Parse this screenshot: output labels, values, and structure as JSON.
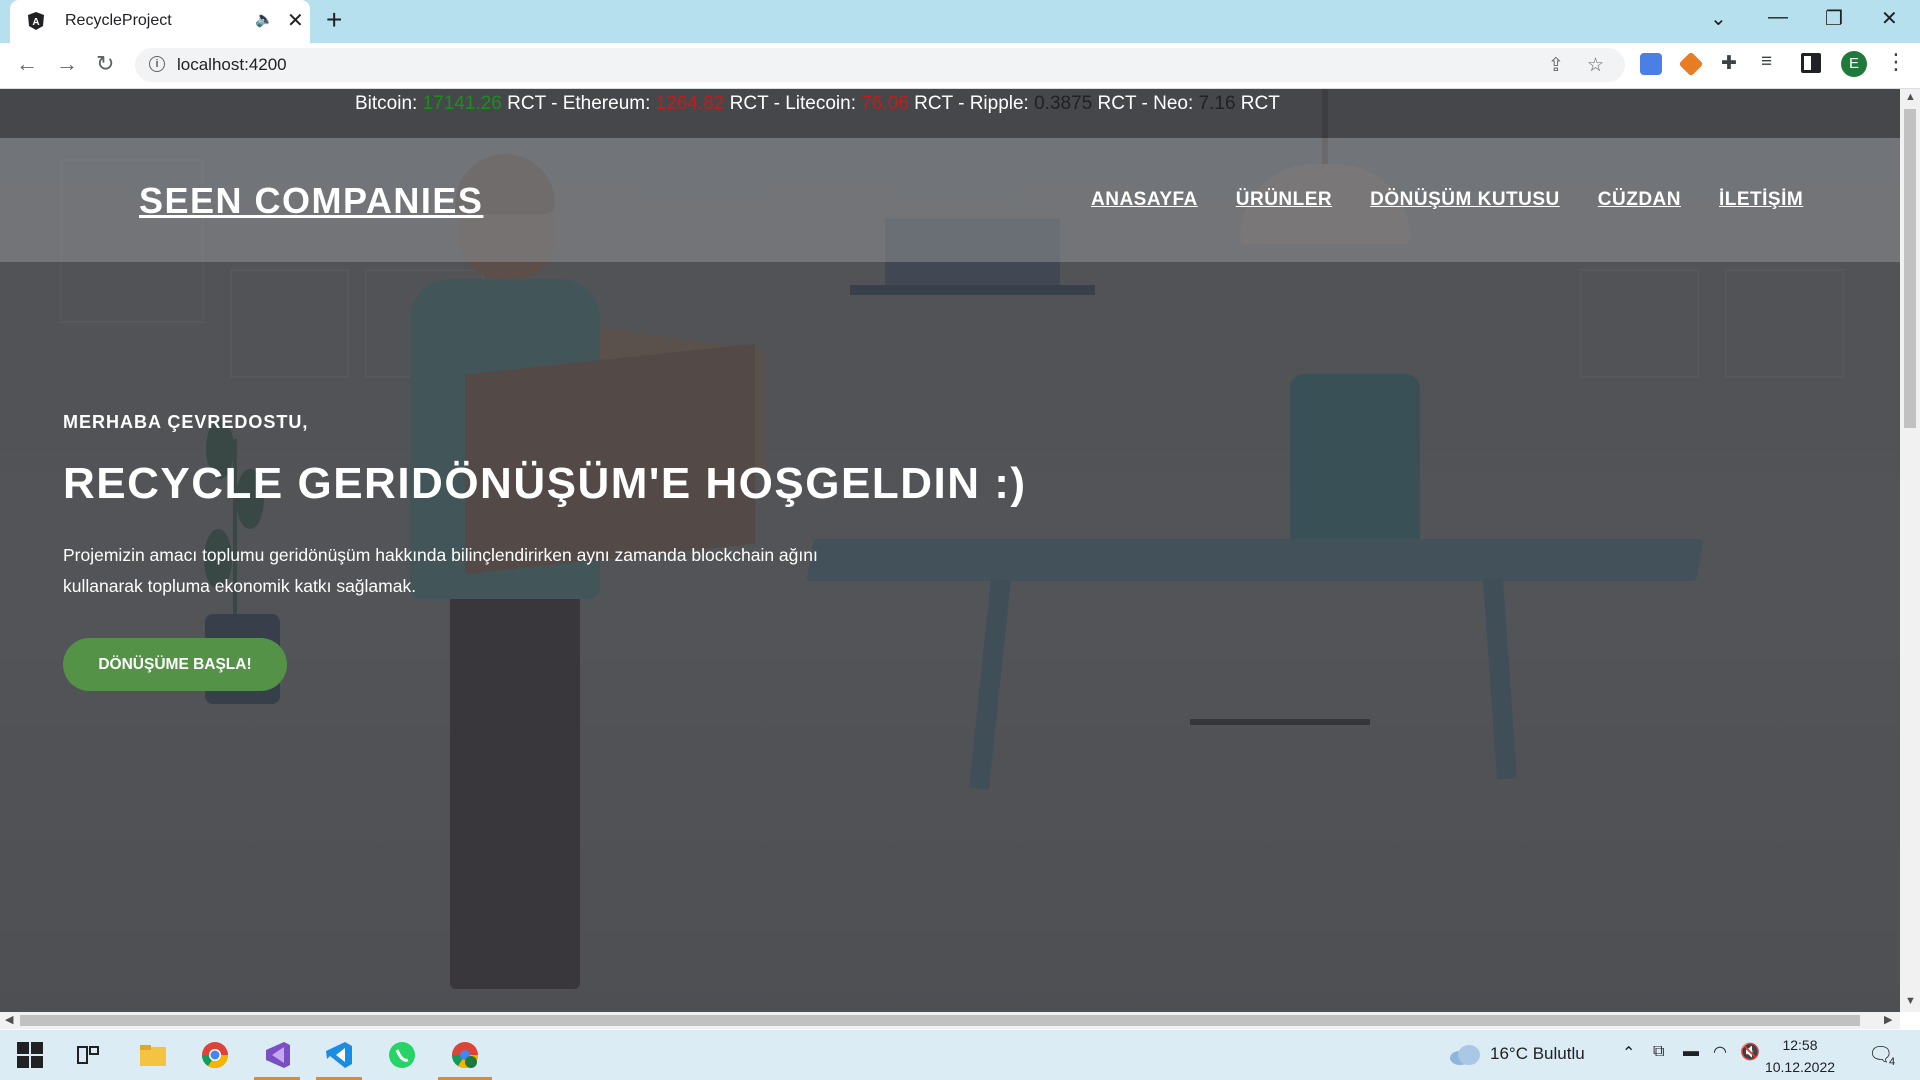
{
  "browser": {
    "tab_title": "RecycleProject",
    "new_tab_symbol": "+",
    "url": "localhost:4200",
    "profile_initial": "E",
    "window_controls": [
      "chevron-down-icon",
      "minimize-icon",
      "restore-icon",
      "close-icon"
    ],
    "extensions": [
      "translate-icon",
      "metamask-fox-icon",
      "puzzle-extensions-icon",
      "media-queue-icon",
      "side-panel-icon"
    ]
  },
  "ticker": {
    "items": [
      {
        "name": "Bitcoin:",
        "value": "17141.26",
        "unit": "RCT",
        "color": "#1a8f1a"
      },
      {
        "name": "Ethereum:",
        "value": "1264.82",
        "unit": "RCT",
        "color": "#c21d1d"
      },
      {
        "name": "Litecoin:",
        "value": "76.06",
        "unit": "RCT",
        "color": "#c21d1d"
      },
      {
        "name": "Ripple:",
        "value": "0.3875",
        "unit": "RCT",
        "color": "#202124"
      },
      {
        "name": "Neo:",
        "value": "7.16",
        "unit": "RCT",
        "color": "#202124"
      }
    ],
    "separator": " - "
  },
  "navbar": {
    "brand": "SEEN COMPANIES",
    "links": [
      "ANASAYFA",
      "ÜRÜNLER",
      "DÖNÜŞÜM KUTUSU",
      "CÜZDAN",
      "İLETİŞİM"
    ]
  },
  "hero": {
    "greeting": "MERHABA ÇEVREDOSTU,",
    "headline": "RECYCLE GERIDÖNÜŞÜM'E HOŞGELDIN :)",
    "description": "Projemizin amacı toplumu geridönüşüm hakkında bilinçlendirirken aynı zamanda blockchain ağını kullanarak topluma ekonomik katkı sağlamak.",
    "cta": "DÖNÜŞÜME BAŞLA!",
    "cta_color": "#549347"
  },
  "taskbar": {
    "apps": [
      "windows-start-icon",
      "task-view-icon",
      "file-explorer-icon",
      "chrome-icon",
      "visual-studio-icon",
      "vscode-icon",
      "whatsapp-icon",
      "chrome-profile-icon"
    ],
    "weather": "16°C  Bulutlu",
    "time": "12:58",
    "date": "10.12.2022",
    "notification_count": "4"
  }
}
